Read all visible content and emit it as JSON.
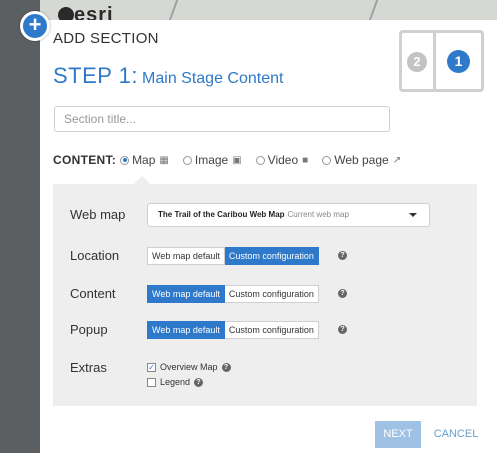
{
  "map": {
    "logo": "esri"
  },
  "dialog": {
    "plus": "+",
    "heading": "ADD SECTION",
    "step_num": "STEP 1:",
    "step_sub": "Main Stage Content",
    "steps": {
      "two": "2",
      "one": "1"
    },
    "title_placeholder": "Section title...",
    "content_label": "CONTENT:",
    "content_options": [
      {
        "label": "Map",
        "selected": true,
        "icon": "map-icon"
      },
      {
        "label": "Image",
        "selected": false,
        "icon": "camera-icon"
      },
      {
        "label": "Video",
        "selected": false,
        "icon": "video-icon"
      },
      {
        "label": "Web page",
        "selected": false,
        "icon": "external-link-icon"
      }
    ],
    "webmap": {
      "label": "Web map",
      "value": "The Trail of the Caribou Web Map",
      "note": "Current web map"
    },
    "location": {
      "label": "Location",
      "opt1": "Web map default",
      "opt2": "Custom configuration",
      "selected": "Custom configuration"
    },
    "content": {
      "label": "Content",
      "opt1": "Web map default",
      "opt2": "Custom configuration",
      "selected": "Web map default"
    },
    "popup": {
      "label": "Popup",
      "opt1": "Web map default",
      "opt2": "Custom configuration",
      "selected": "Web map default"
    },
    "extras": {
      "label": "Extras",
      "overview": {
        "label": "Overview Map",
        "checked": true
      },
      "legend": {
        "label": "Legend",
        "checked": false
      }
    },
    "help_glyph": "?",
    "next": "NEXT",
    "cancel": "CANCEL"
  },
  "colors": {
    "accent": "#2e79c9",
    "next_disabled": "#9fc1e3",
    "panel": "#eeeeee"
  }
}
